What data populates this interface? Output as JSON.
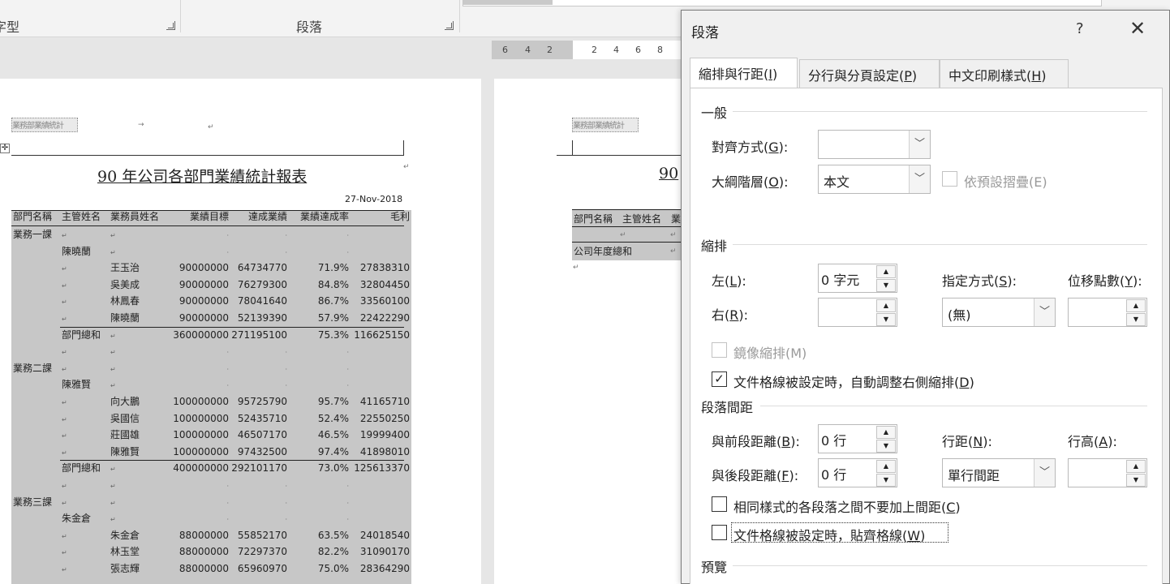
{
  "ribbon": {
    "group_font_label": "字型",
    "group_paragraph_label": "段落"
  },
  "ruler": {
    "ticks": [
      "6",
      "4",
      "2",
      "2",
      "4",
      "6",
      "8"
    ]
  },
  "document": {
    "header_text": "業務部業績統計",
    "title": "90 年公司各部門業績統計報表",
    "title_partial": "90",
    "date": "27-Nov-2018",
    "columns": [
      "部門名稱",
      "主管姓名",
      "業務員姓名",
      "業績目標",
      "達成業績",
      "業績達成率",
      "毛利"
    ],
    "rows": [
      [
        "業務一課",
        "",
        "",
        "",
        "",
        "",
        ""
      ],
      [
        "",
        "陳曉蘭",
        "",
        "",
        "",
        "",
        ""
      ],
      [
        "",
        "",
        "王玉治",
        "90000000",
        "64734770",
        "71.9%",
        "27838310"
      ],
      [
        "",
        "",
        "吳美成",
        "90000000",
        "76279300",
        "84.8%",
        "32804450"
      ],
      [
        "",
        "",
        "林鳳春",
        "90000000",
        "78041640",
        "86.7%",
        "33560100"
      ],
      [
        "",
        "",
        "陳曉蘭",
        "90000000",
        "52139390",
        "57.9%",
        "22422290"
      ],
      [
        "",
        "部門總和",
        "",
        "360000000",
        "271195100",
        "75.3%",
        "116625150"
      ],
      [
        "",
        "",
        "",
        "",
        "",
        "",
        ""
      ],
      [
        "業務二課",
        "",
        "",
        "",
        "",
        "",
        ""
      ],
      [
        "",
        "陳雅賢",
        "",
        "",
        "",
        "",
        ""
      ],
      [
        "",
        "",
        "向大鵬",
        "100000000",
        "95725790",
        "95.7%",
        "41165710"
      ],
      [
        "",
        "",
        "吳國信",
        "100000000",
        "52435710",
        "52.4%",
        "22550250"
      ],
      [
        "",
        "",
        "莊國雄",
        "100000000",
        "46507170",
        "46.5%",
        "19999400"
      ],
      [
        "",
        "",
        "陳雅賢",
        "100000000",
        "97432500",
        "97.4%",
        "41898010"
      ],
      [
        "",
        "部門總和",
        "",
        "400000000",
        "292101170",
        "73.0%",
        "125613370"
      ],
      [
        "",
        "",
        "",
        "",
        "",
        "",
        ""
      ],
      [
        "業務三課",
        "",
        "",
        "",
        "",
        "",
        ""
      ],
      [
        "",
        "朱金倉",
        "",
        "",
        "",
        "",
        ""
      ],
      [
        "",
        "",
        "朱金倉",
        "88000000",
        "55852170",
        "63.5%",
        "24018540"
      ],
      [
        "",
        "",
        "林玉堂",
        "88000000",
        "72297370",
        "82.2%",
        "31090170"
      ],
      [
        "",
        "",
        "張志輝",
        "88000000",
        "65960970",
        "75.0%",
        "28364290"
      ]
    ],
    "right_page_columns": [
      "部門名稱",
      "主管姓名",
      "業"
    ],
    "right_page_total_label": "公司年度總和"
  },
  "dialog": {
    "title": "段落",
    "help": "?",
    "close": "✕",
    "tabs": [
      {
        "label": "縮排與行距(",
        "key": "I",
        "end": ")"
      },
      {
        "label": "分行與分頁設定(",
        "key": "P",
        "end": ")"
      },
      {
        "label": "中文印刷樣式(",
        "key": "H",
        "end": ")"
      }
    ],
    "general": {
      "heading": "一般",
      "alignment_label": "對齊方式(",
      "alignment_key": "G",
      "alignment_end": "):",
      "alignment_value": "",
      "outline_label": "大綱階層(",
      "outline_key": "O",
      "outline_end": "):",
      "outline_value": "本文",
      "collapse_label": "依預設摺疊(E)"
    },
    "indent": {
      "heading": "縮排",
      "left_label": "左(",
      "left_key": "L",
      "left_end": "):",
      "left_value": "0 字元",
      "right_label": "右(",
      "right_key": "R",
      "right_end": "):",
      "right_value": "",
      "special_label": "指定方式(",
      "special_key": "S",
      "special_end": "):",
      "special_value": "(無)",
      "by_label": "位移點數(",
      "by_key": "Y",
      "by_end": "):",
      "by_value": "",
      "mirror_label": "鏡像縮排(M)",
      "auto_adjust_label": "文件格線被設定時，自動調整右側縮排(",
      "auto_adjust_key": "D",
      "auto_adjust_end": ")",
      "auto_adjust_checked": true
    },
    "spacing": {
      "heading": "段落間距",
      "before_label": "與前段距離(",
      "before_key": "B",
      "before_end": "):",
      "before_value": "0 行",
      "after_label": "與後段距離(",
      "after_key": "F",
      "after_end": "):",
      "after_value": "0 行",
      "line_spacing_label": "行距(",
      "line_spacing_key": "N",
      "line_spacing_end": "):",
      "line_spacing_value": "單行間距",
      "at_label": "行高(",
      "at_key": "A",
      "at_end": "):",
      "at_value": "",
      "no_space_label": "相同樣式的各段落之間不要加上間距(",
      "no_space_key": "C",
      "no_space_end": ")",
      "snap_grid_label": "文件格線被設定時，貼齊格線(",
      "snap_grid_key": "W",
      "snap_grid_end": ")"
    },
    "preview": {
      "heading": "預覽"
    }
  }
}
